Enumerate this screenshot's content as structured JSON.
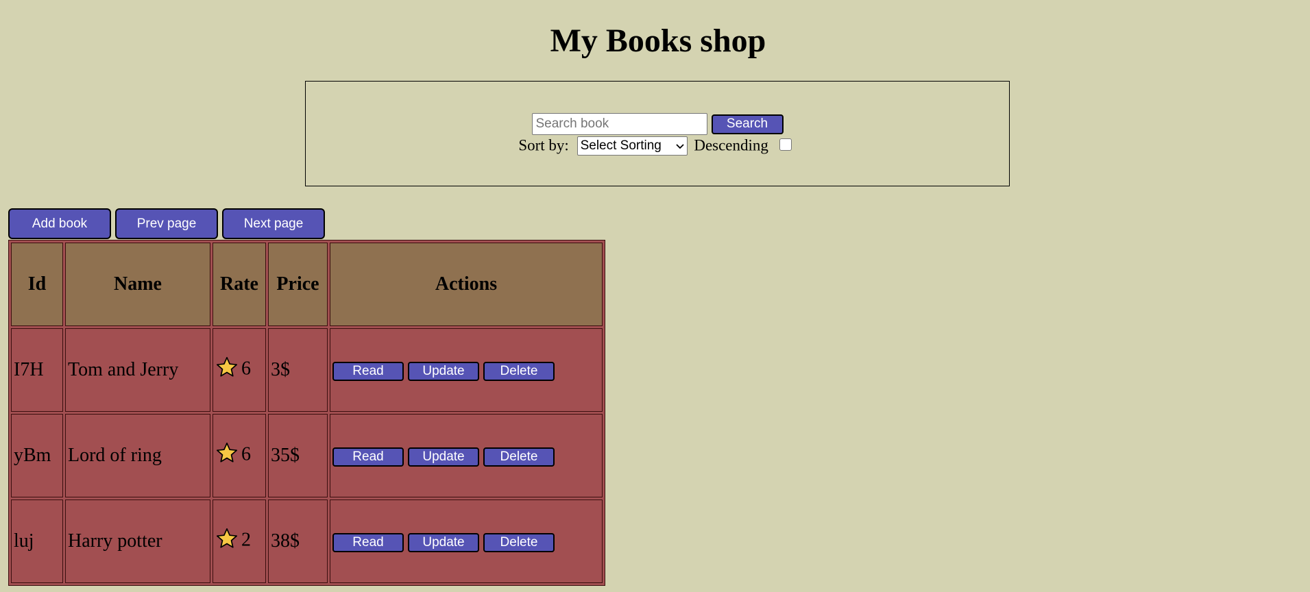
{
  "header": {
    "title": "My Books shop"
  },
  "search": {
    "placeholder": "Search book",
    "value": "",
    "button_label": "Search",
    "sort_label": "Sort by:",
    "sort_selected": "Select Sorting",
    "descending_label": "Descending",
    "descending_checked": false
  },
  "toolbar": {
    "add_label": "Add book",
    "prev_label": "Prev page",
    "next_label": "Next page"
  },
  "table": {
    "columns": [
      "Id",
      "Name",
      "Rate",
      "Price",
      "Actions"
    ],
    "rows": [
      {
        "id": "I7H",
        "name": "Tom and Jerry",
        "rate": "6",
        "price": "3$"
      },
      {
        "id": "yBm",
        "name": "Lord of ring",
        "rate": "6",
        "price": "35$"
      },
      {
        "id": "luj",
        "name": "Harry potter",
        "rate": "2",
        "price": "38$"
      }
    ],
    "actions": {
      "read": "Read",
      "update": "Update",
      "delete": "Delete"
    }
  },
  "colors": {
    "background": "#d4d3b1",
    "button": "#5654b5",
    "header_cell": "#8f7150",
    "row_cell": "#a24f51",
    "star": "#f6c744"
  },
  "icons": {
    "rate": "star-icon",
    "sort_dropdown": "chevron-down-icon"
  }
}
